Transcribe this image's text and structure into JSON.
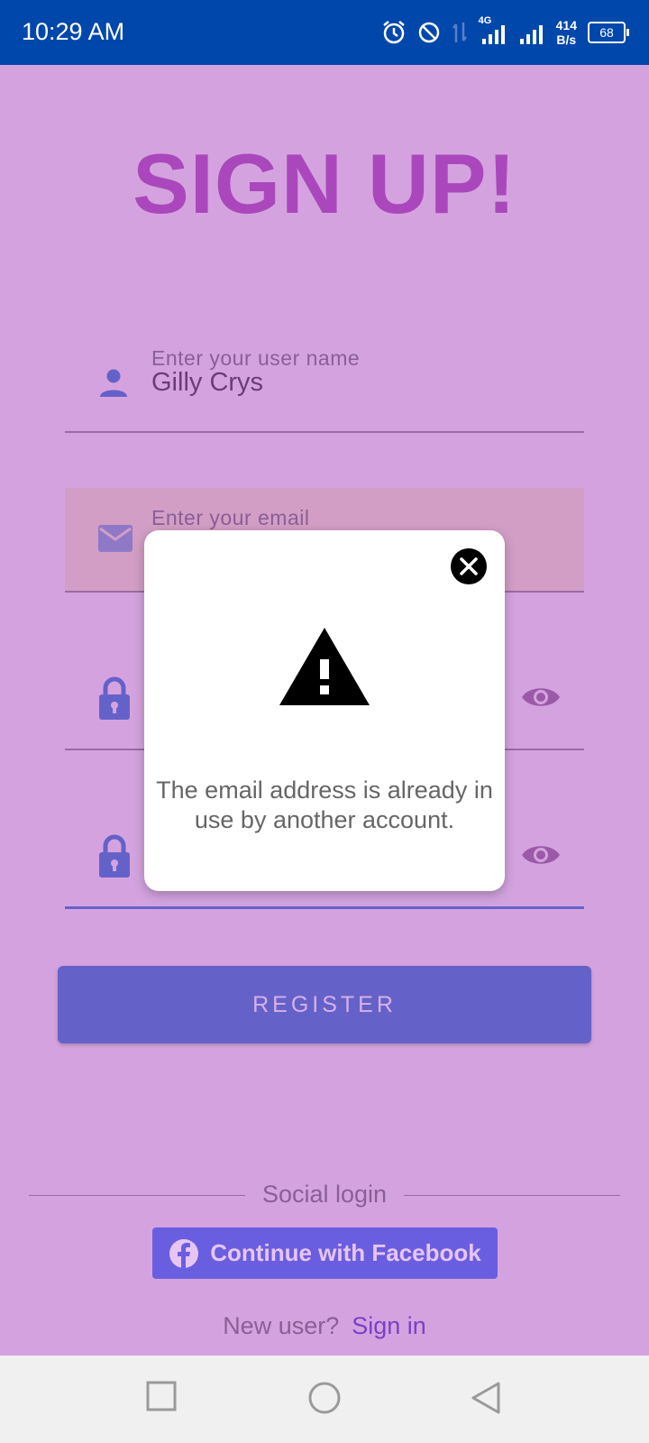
{
  "status_bar": {
    "time": "10:29 AM",
    "network_type": "4G",
    "speed_value": "414",
    "speed_unit": "B/s",
    "battery": "68"
  },
  "title": "SIGN UP!",
  "fields": {
    "username": {
      "label": "Enter your user name",
      "value": "Gilly Crys",
      "icon": "person-icon"
    },
    "email": {
      "label": "Enter your email",
      "value": "",
      "icon": "mail-icon"
    },
    "password": {
      "icon": "lock-icon"
    },
    "confirm_password": {
      "icon": "lock-icon"
    }
  },
  "register_button": "REGISTER",
  "social_login_label": "Social login",
  "facebook_button": "Continue with Facebook",
  "footer": {
    "prompt": "New user?",
    "link": "Sign in"
  },
  "modal": {
    "message": "The email address is already in use by another account.",
    "icon": "warning-icon"
  },
  "colors": {
    "background": "#d4a3df",
    "status_bar": "#0047ab",
    "accent": "#6462c9",
    "title": "#ab47bc"
  }
}
